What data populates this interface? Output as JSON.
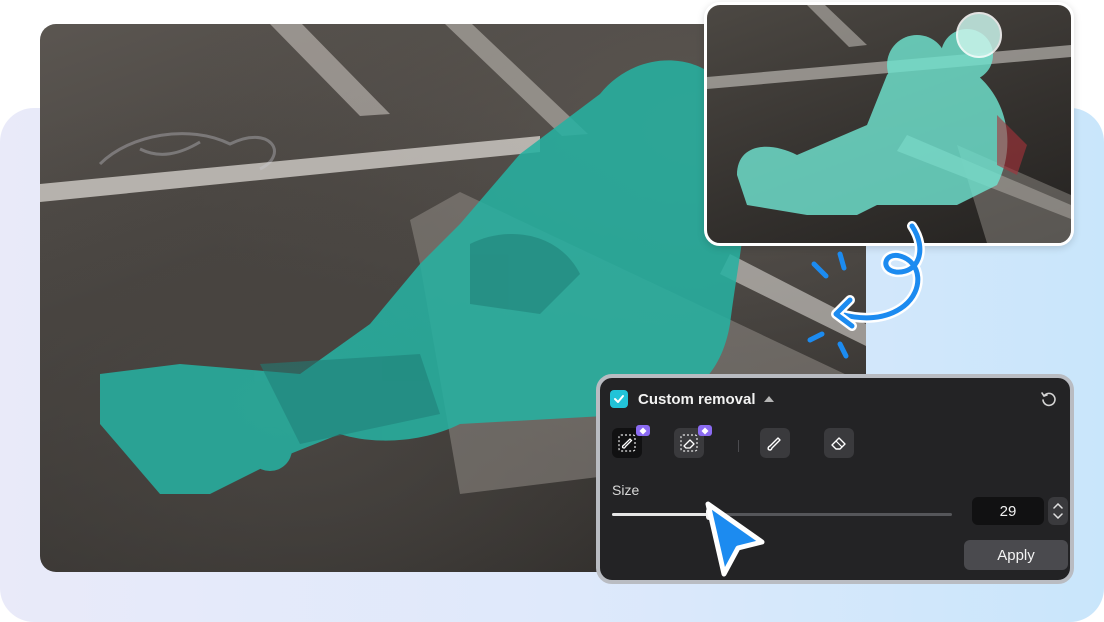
{
  "panel": {
    "title": "Custom removal",
    "size_label": "Size",
    "size_value": "29",
    "size_fraction": 0.29,
    "apply_label": "Apply",
    "tools": [
      "brush-select-icon",
      "erase-select-icon",
      "brush-icon",
      "eraser-icon"
    ],
    "active_tool": 0
  },
  "colors": {
    "accent": "#22c3d8",
    "mask": "#27b0a0",
    "panel_bg": "#232325",
    "cursor": "#1c8bf0",
    "premium_badge": "#8b6bf2"
  },
  "icons": {
    "checkbox": "check-icon",
    "reset": "reset-icon",
    "cursor": "pointer-cursor-icon",
    "arrow": "curved-arrow-icon"
  }
}
